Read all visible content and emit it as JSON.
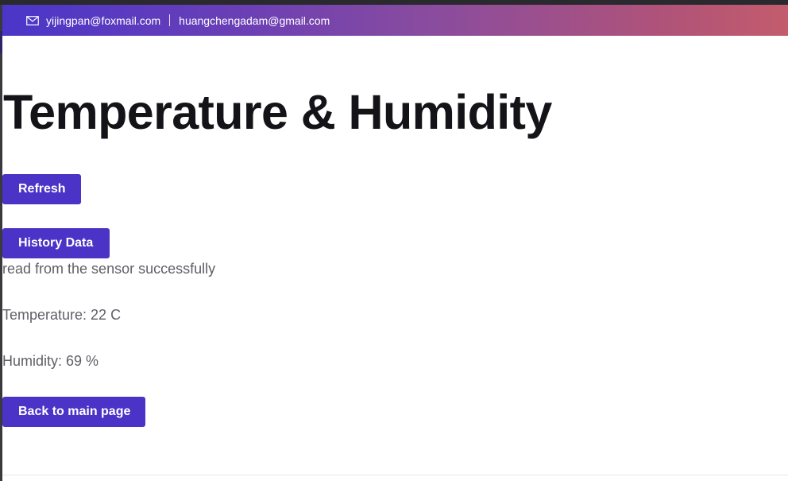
{
  "header": {
    "icon": "mail-icon",
    "email_primary": "yijingpan@foxmail.com",
    "email_secondary": "huangchengadam@gmail.com",
    "gradient_start": "#4a36c9",
    "gradient_end": "#c35c6c"
  },
  "main": {
    "title": "Temperature & Humidity",
    "refresh_label": "Refresh",
    "history_label": "History Data",
    "status_text": "read from the sensor successfully",
    "temperature_text": "Temperature: 22 C",
    "humidity_text": "Humidity: 69 %",
    "back_label": "Back to main page",
    "button_color": "#4a33c6"
  }
}
